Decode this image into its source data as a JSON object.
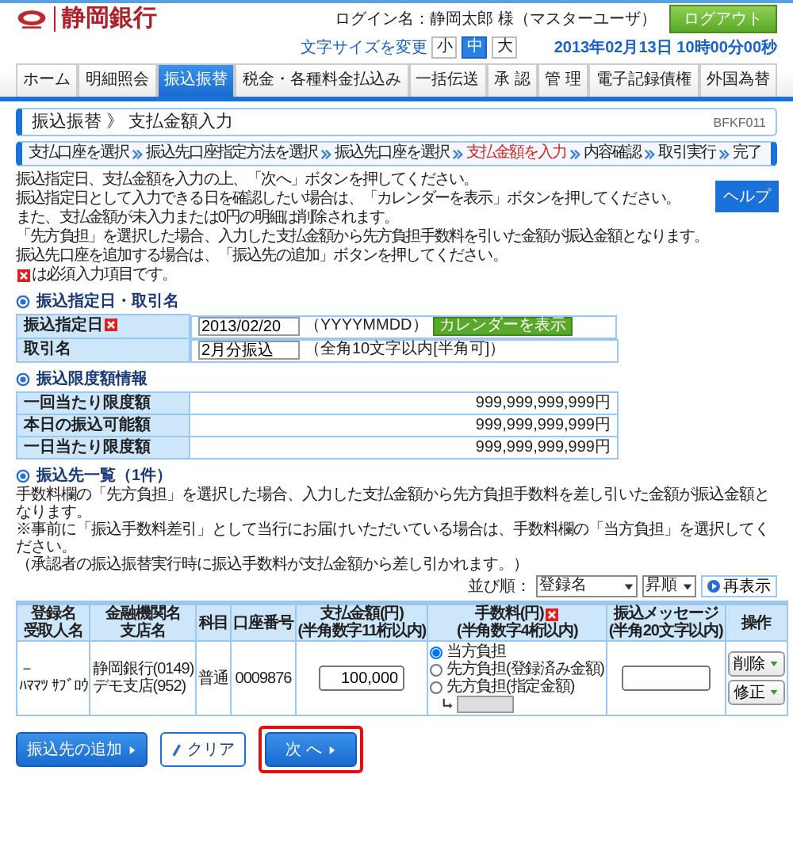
{
  "header": {
    "logo": "静岡銀行",
    "login": "ログイン名：静岡太郎 様（マスターユーザ）",
    "logout": "ログアウト",
    "font_size_label": "文字サイズを変更",
    "font_sizes": [
      {
        "label": "小",
        "selected": false
      },
      {
        "label": "中",
        "selected": true
      },
      {
        "label": "大",
        "selected": false
      }
    ],
    "datetime": "2013年02月13日 10時00分00秒"
  },
  "tabs": [
    {
      "label": "ホーム",
      "selected": false
    },
    {
      "label": "明細照会",
      "selected": false
    },
    {
      "label": "振込振替",
      "selected": true
    },
    {
      "label": "税金・各種料金払込み",
      "selected": false
    },
    {
      "label": "一括伝送",
      "selected": false
    },
    {
      "label": "承 認",
      "selected": false
    },
    {
      "label": "管 理",
      "selected": false
    },
    {
      "label": "電子記録債権",
      "selected": false
    },
    {
      "label": "外国為替",
      "selected": false
    }
  ],
  "page_title": "振込振替 》 支払金額入力",
  "screen_id": "BFKF011",
  "steps": [
    {
      "label": "支払口座を選択",
      "selected": false
    },
    {
      "label": "振込先口座指定方法を選択",
      "selected": false
    },
    {
      "label": "振込先口座を選択",
      "selected": false
    },
    {
      "label": "支払金額を入力",
      "selected": true
    },
    {
      "label": "内容確認",
      "selected": false
    },
    {
      "label": "取引実行",
      "selected": false
    },
    {
      "label": "完了",
      "selected": false
    }
  ],
  "help": "ヘルプ",
  "instructions": [
    "振込指定日、支払金額を入力の上、「次へ」ボタンを押してください。",
    "振込指定日として入力できる日を確認したい場合は、「カレンダーを表示」ボタンを押してください。",
    "また、支払金額が未入力または0円の明細は削除されます。",
    "「先方負担」を選択した場合、入力した支払金額から先方負担手数料を引いた金額が振込金額となります。",
    "振込先口座を追加する場合は、「振込先の追加」ボタンを押してください。"
  ],
  "required_note": "は必須入力項目です。",
  "designation": {
    "title": "振込指定日・取引名",
    "rows": [
      {
        "label": "振込指定日",
        "required": true,
        "value": "2013/02/20",
        "hint": "（YYYYMMDD）",
        "button": "カレンダーを表示"
      },
      {
        "label": "取引名",
        "required": false,
        "value": "2月分振込",
        "hint": "（全角10文字以内[半角可]）"
      }
    ]
  },
  "limits": {
    "title": "振込限度額情報",
    "rows": [
      {
        "label": "一回当たり限度額",
        "value": "999,999,999,999円"
      },
      {
        "label": "本日の振込可能額",
        "value": "999,999,999,999円"
      },
      {
        "label": "一日当たり限度額",
        "value": "999,999,999,999円"
      }
    ]
  },
  "payees": {
    "title": "振込先一覧（1件）",
    "notes": [
      "手数料欄の「先方負担」を選択した場合、入力した支払金額から先方負担手数料を差し引いた金額が振込金額となります。",
      "※事前に「振込手数料差引」として当行にお届けいただいている場合は、手数料欄の「当方負担」を選択してください。",
      "（承認者の振込振替実行時に振込手数料が支払金額から差し引かれます。）"
    ],
    "sort_label": "並び順：",
    "sort_field": "登録名",
    "sort_order": "昇順",
    "refresh": "再表示",
    "columns": [
      {
        "lines": [
          "登録名",
          "受取人名"
        ],
        "required": false
      },
      {
        "lines": [
          "金融機関名",
          "支店名"
        ],
        "required": false
      },
      {
        "lines": [
          "科目"
        ],
        "required": false
      },
      {
        "lines": [
          "口座番号"
        ],
        "required": false
      },
      {
        "lines": [
          "支払金額(円)",
          "(半角数字11桁以内)"
        ],
        "required": false
      },
      {
        "lines": [
          "手数料(円)",
          "(半角数字4桁以内)"
        ],
        "required": true
      },
      {
        "lines": [
          "振込メッセージ",
          "(半角20文字以内)"
        ],
        "required": false
      },
      {
        "lines": [
          "操作"
        ],
        "required": false
      }
    ],
    "rows": [
      {
        "name": "－",
        "kana": "ﾊﾏﾏﾂ ｻﾌﾞﾛｳ",
        "bank": "静岡銀行(0149)",
        "branch": "デモ支店(952)",
        "type": "普通",
        "account": "0009876",
        "amount": "100,000",
        "fee_options": [
          {
            "label": "当方負担",
            "selected": true
          },
          {
            "label": "先方負担(登録済み金額)",
            "selected": false
          },
          {
            "label": "先方負担(指定金額)",
            "selected": false
          }
        ],
        "actions": [
          "削除",
          "修正"
        ]
      }
    ]
  },
  "buttons": [
    {
      "label": "振込先の追加",
      "kind": "add"
    },
    {
      "label": "クリア",
      "kind": "clear"
    },
    {
      "label": "次 へ",
      "kind": "next"
    }
  ]
}
